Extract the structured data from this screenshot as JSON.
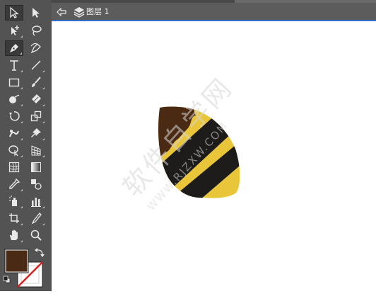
{
  "document_tab": {
    "layer_label": "图层 1"
  },
  "colors": {
    "toolbar_bg": "#535353",
    "fill": "#4a2a14",
    "bee_yellow": "#e9c53a",
    "bee_stripe": "#1d1c1a",
    "bee_head": "#4b2a14",
    "accent_line": "#2f6fcb",
    "watermark": "#ececec"
  },
  "watermark": {
    "text": "软件自学网",
    "url": "WWW.RJZXW.COM"
  },
  "tools": [
    "selection-tool",
    "direct-selection-tool",
    "anchor-add-tool",
    "lasso-tool",
    "pen-tool",
    "curvature-tool",
    "type-tool",
    "line-tool",
    "rectangle-tool",
    "paintbrush-tool",
    "shaper-tool",
    "eraser-tool",
    "rotate-tool",
    "scale-tool",
    "warp-tool",
    "puppet-warp-tool",
    "shape-builder-tool",
    "perspective-grid-tool",
    "mesh-tool",
    "gradient-tool",
    "eyedropper-tool",
    "blend-tool",
    "symbol-sprayer-tool",
    "column-graph-tool",
    "artboard-tool",
    "slice-tool",
    "hand-tool",
    "zoom-tool"
  ]
}
